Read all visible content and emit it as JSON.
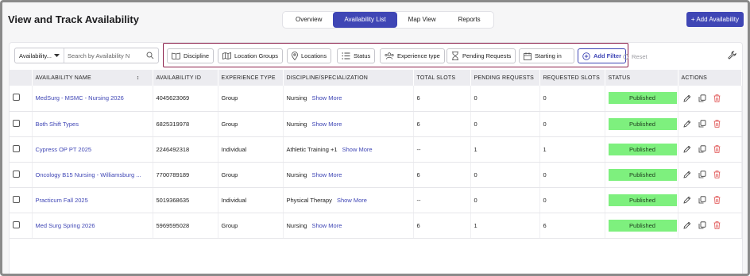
{
  "header": {
    "title": "View and Track Availability",
    "add_button": "+ Add Availability"
  },
  "tabs": [
    {
      "label": "Overview",
      "active": false
    },
    {
      "label": "Availability List",
      "active": true
    },
    {
      "label": "Map View",
      "active": false
    },
    {
      "label": "Reports",
      "active": false
    }
  ],
  "search": {
    "select_value": "Availability...",
    "placeholder": "Search by Availability N"
  },
  "filters": {
    "discipline": "Discipline",
    "location_groups": "Location Groups",
    "locations": "Locations",
    "status": "Status",
    "experience_type": "Experience type",
    "pending_requests": "Pending Requests",
    "starting_in": "Starting in",
    "add_filter": "Add Filter",
    "reset": "Reset"
  },
  "columns": {
    "name": "AVAILABILITY NAME",
    "id": "AVAILABILITY ID",
    "experience": "EXPERIENCE TYPE",
    "discipline": "DISCIPLINE/SPECIALIZATION",
    "total": "TOTAL SLOTS",
    "pending": "PENDING REQUESTS",
    "requested": "REQUESTED SLOTS",
    "status": "STATUS",
    "actions": "ACTIONS"
  },
  "show_more": "Show More",
  "rows": [
    {
      "name": "MedSurg - MSMC - Nursing 2026",
      "id": "4045623069",
      "experience": "Group",
      "discipline": "Nursing",
      "extra": "",
      "total": "6",
      "pending": "0",
      "requested": "0",
      "status": "Published"
    },
    {
      "name": "Both Shift Types",
      "id": "6825319978",
      "experience": "Group",
      "discipline": "Nursing",
      "extra": "",
      "total": "6",
      "pending": "0",
      "requested": "0",
      "status": "Published"
    },
    {
      "name": "Cypress OP PT 2025",
      "id": "2246492318",
      "experience": "Individual",
      "discipline": "Athletic Training",
      "extra": "+1",
      "total": "--",
      "pending": "1",
      "requested": "1",
      "status": "Published"
    },
    {
      "name": "Oncology B15 Nursing - Williamsburg ...",
      "id": "7700789189",
      "experience": "Group",
      "discipline": "Nursing",
      "extra": "",
      "total": "6",
      "pending": "0",
      "requested": "0",
      "status": "Published"
    },
    {
      "name": "Practicum Fall 2025",
      "id": "5019368635",
      "experience": "Individual",
      "discipline": "Physical Therapy",
      "extra": "",
      "total": "--",
      "pending": "0",
      "requested": "0",
      "status": "Published"
    },
    {
      "name": "Med Surg Spring 2026",
      "id": "5969595028",
      "experience": "Group",
      "discipline": "Nursing",
      "extra": "",
      "total": "6",
      "pending": "1",
      "requested": "6",
      "status": "Published"
    }
  ],
  "colors": {
    "accent": "#3f46b5",
    "published": "#7ef07e",
    "filter_highlight": "#8b1e4a",
    "delete": "#e05050"
  }
}
